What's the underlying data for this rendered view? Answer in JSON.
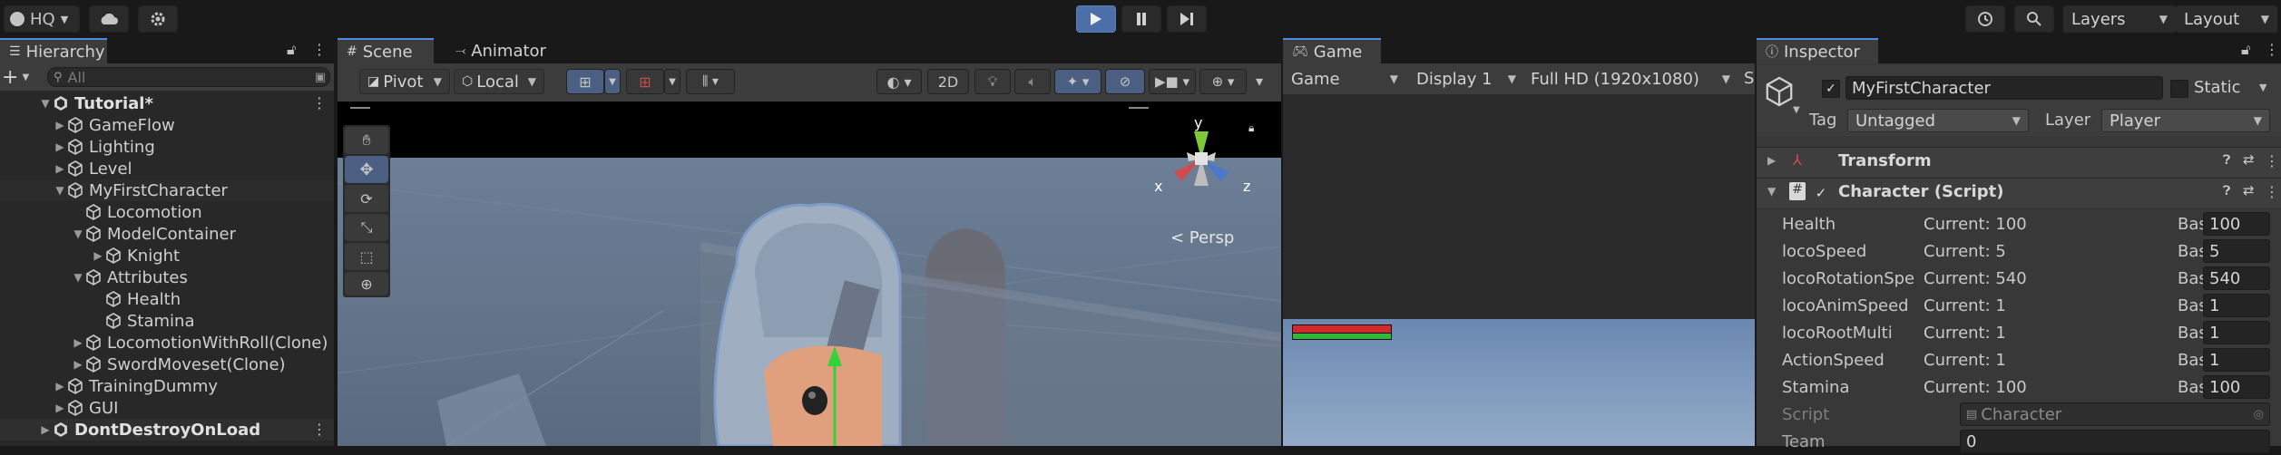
{
  "toolbar": {
    "account_label": "HQ",
    "layers_label": "Layers",
    "layout_label": "Layout"
  },
  "hierarchy": {
    "tab_label": "Hierarchy",
    "search_placeholder": "All",
    "items": [
      {
        "label": "Tutorial*",
        "bold": true
      },
      {
        "label": "GameFlow"
      },
      {
        "label": "Lighting"
      },
      {
        "label": "Level"
      },
      {
        "label": "MyFirstCharacter"
      },
      {
        "label": "Locomotion"
      },
      {
        "label": "ModelContainer"
      },
      {
        "label": "Knight"
      },
      {
        "label": "Attributes"
      },
      {
        "label": "Health"
      },
      {
        "label": "Stamina"
      },
      {
        "label": "LocomotionWithRoll(Clone)"
      },
      {
        "label": "SwordMoveset(Clone)"
      },
      {
        "label": "TrainingDummy"
      },
      {
        "label": "GUI"
      },
      {
        "label": "DontDestroyOnLoad",
        "bold": true
      }
    ]
  },
  "scene": {
    "tab_scene": "Scene",
    "tab_animator": "Animator",
    "pivot_label": "Pivot",
    "local_label": "Local",
    "mode_2d": "2D",
    "gizmo_y": "y",
    "gizmo_x": "x",
    "gizmo_z": "z",
    "persp_label": "< Persp"
  },
  "game": {
    "tab_label": "Game",
    "view_dropdown": "Game",
    "display_dropdown": "Display 1",
    "resolution_dropdown": "Full HD (1920x1080)",
    "s_label": "S"
  },
  "inspector": {
    "tab_label": "Inspector",
    "object_name": "MyFirstCharacter",
    "static_label": "Static",
    "tag_label": "Tag",
    "tag_value": "Untagged",
    "layer_label": "Layer",
    "layer_value": "Player",
    "transform_label": "Transform",
    "character_label": "Character (Script)",
    "stats": [
      {
        "name": "Health",
        "current": "Current: 100",
        "base_label": "Base:",
        "base": "100"
      },
      {
        "name": "locoSpeed",
        "current": "Current: 5",
        "base_label": "Base:",
        "base": "5"
      },
      {
        "name": "locoRotationSpe",
        "current": "Current: 540",
        "base_label": "Base:",
        "base": "540"
      },
      {
        "name": "locoAnimSpeed",
        "current": "Current: 1",
        "base_label": "Base:",
        "base": "1"
      },
      {
        "name": "locoRootMulti",
        "current": "Current: 1",
        "base_label": "Base:",
        "base": "1"
      },
      {
        "name": "ActionSpeed",
        "current": "Current: 1",
        "base_label": "Base:",
        "base": "1"
      },
      {
        "name": "Stamina",
        "current": "Current: 100",
        "base_label": "Base:",
        "base": "100"
      }
    ],
    "script_label": "Script",
    "script_value": "Character",
    "team_label": "Team",
    "team_value": "0"
  }
}
